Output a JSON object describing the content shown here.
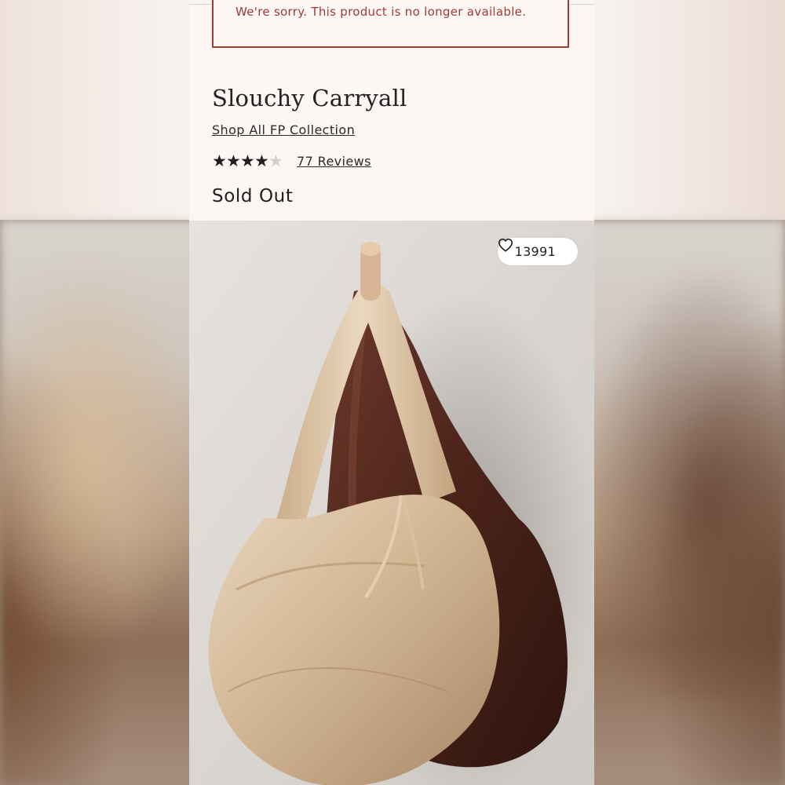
{
  "alert": {
    "message": "We're sorry. This product is no longer available."
  },
  "product": {
    "title": "Slouchy Carryall",
    "collection_link": "Shop All FP Collection",
    "rating": {
      "value": 4.0,
      "max": 5
    },
    "reviews_label": "77 Reviews",
    "status": "Sold Out"
  },
  "gallery": {
    "likes_count": "13991",
    "heart_icon": "heart-outline-icon"
  },
  "colors": {
    "alert_red": "#a53a30",
    "gold_bag": "#cfb394",
    "brown_bag": "#4a2219"
  }
}
